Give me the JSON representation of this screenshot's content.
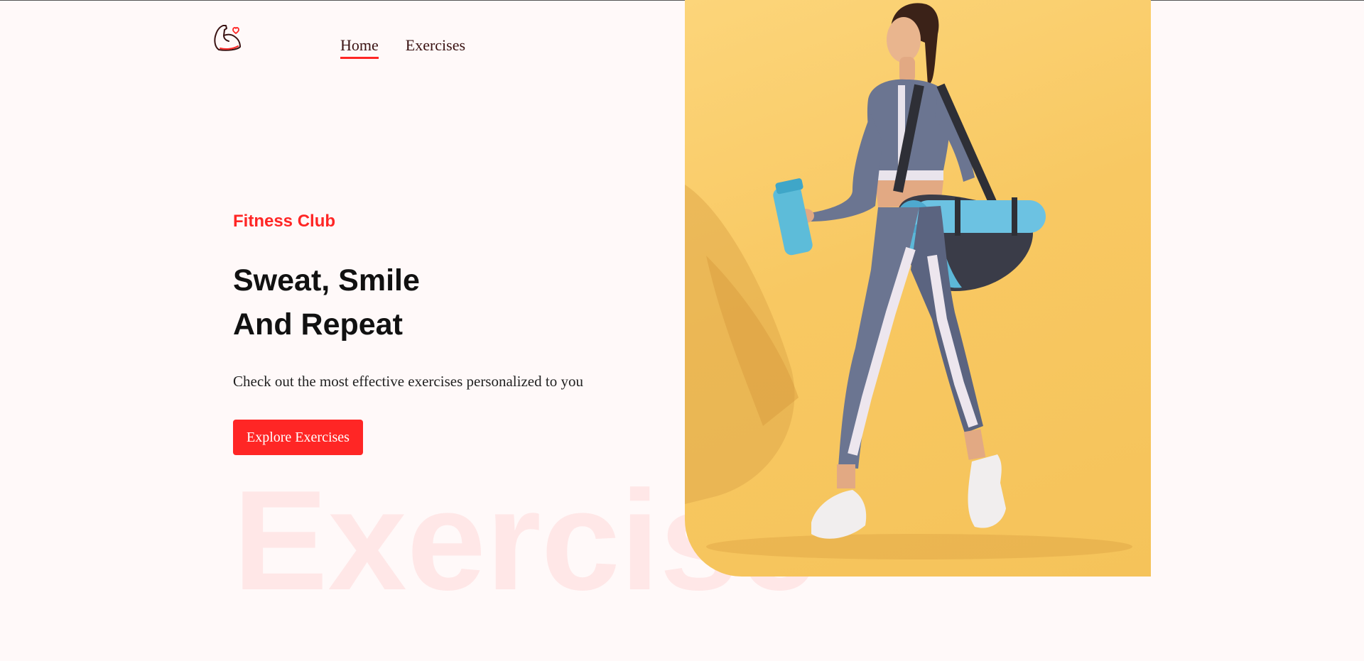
{
  "header": {
    "logo_icon": "flexed-arm-heart-icon",
    "nav": [
      {
        "label": "Home",
        "active": true
      },
      {
        "label": "Exercises",
        "active": false
      }
    ]
  },
  "hero": {
    "eyebrow": "Fitness Club",
    "headline_line1": "Sweat, Smile",
    "headline_line2": "And Repeat",
    "subtext": "Check out the most effective exercises personalized to you",
    "cta_label": "Explore Exercises",
    "watermark": "Exercise"
  },
  "colors": {
    "accent": "#ff2625",
    "background": "#fff9f9",
    "photo_background": "#f8c862"
  }
}
